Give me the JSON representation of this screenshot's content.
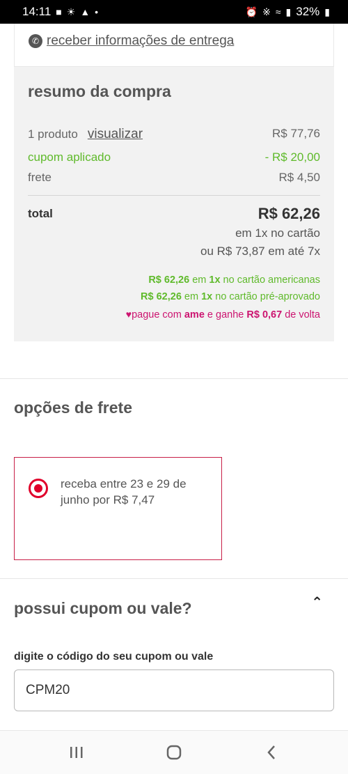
{
  "status_bar": {
    "time": "14:11",
    "battery": "32%"
  },
  "delivery": {
    "link_text": "receber informações de entrega"
  },
  "summary": {
    "title": "resumo da compra",
    "product_label": "1 produto",
    "product_link": "visualizar",
    "product_value": "R$ 77,76",
    "coupon_label": "cupom aplicado",
    "coupon_value": "- R$ 20,00",
    "shipping_label": "frete",
    "shipping_value": "R$ 4,50",
    "total_label": "total",
    "total_value": "R$ 62,26",
    "installment_1": "em 1x no cartão",
    "installment_2": "ou R$ 73,87 em até 7x",
    "promo_card_value": "R$ 62,26",
    "promo_card_em": " em ",
    "promo_card_times": "1x",
    "promo_card_text": " no cartão americanas",
    "promo_pre_value": "R$ 62,26",
    "promo_pre_em": " em ",
    "promo_pre_times": "1x",
    "promo_pre_text": " no cartão pré-aprovado",
    "ame_prefix": "pague com ",
    "ame_brand": "ame",
    "ame_mid": " e ganhe ",
    "ame_value": "R$ 0,67",
    "ame_suffix": " de volta"
  },
  "shipping_options": {
    "title": "opções de frete",
    "option_text": "receba entre 23 e 29 de junho por R$ 7,47"
  },
  "coupon": {
    "title": "possui cupom ou vale?",
    "field_label": "digite o código do seu cupom ou vale",
    "field_value": "CPM20"
  },
  "colors": {
    "green": "#5fba2b",
    "pink": "#cc1470",
    "red": "#e0002b"
  }
}
